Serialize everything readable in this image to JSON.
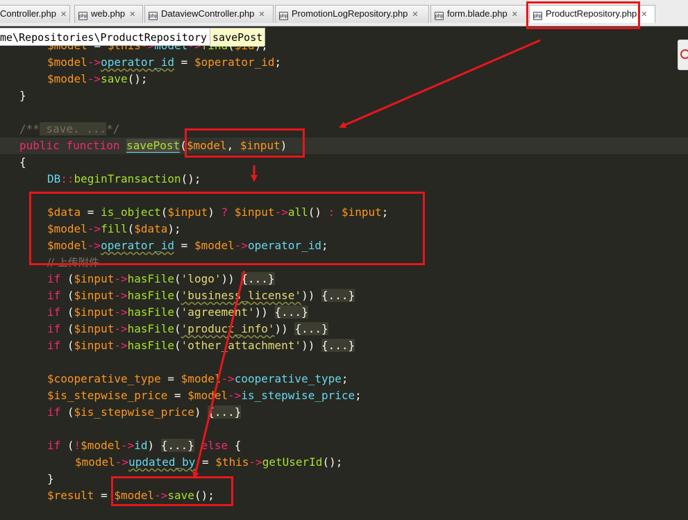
{
  "tabs": [
    {
      "label": "Controller.php",
      "close": "✕"
    },
    {
      "label": "web.php",
      "close": "✕"
    },
    {
      "label": "DataviewController.php",
      "close": "✕"
    },
    {
      "label": "PromotionLogRepository.php",
      "close": "✕"
    },
    {
      "label": "form.blade.php",
      "close": "✕"
    },
    {
      "label": "ProductRepository.php",
      "close": "✕",
      "active": true
    }
  ],
  "tab_icon_text": "php",
  "breadcrumb": {
    "path": "me\\Repositories\\ProductRepository",
    "method": "savePost"
  },
  "code": {
    "l0": [
      "$model",
      " = ",
      "$this",
      "->",
      "model",
      "->",
      "find",
      "(",
      "$id",
      ");"
    ],
    "l1": [
      "$model",
      "->",
      "operator_id",
      " = ",
      "$operator_id",
      ";"
    ],
    "l2": [
      "$model",
      "->",
      "save",
      "();"
    ],
    "l3": [
      "}"
    ],
    "l5": [
      "/**",
      " save. ...",
      "*/"
    ],
    "l6": [
      "public",
      " ",
      "function",
      " ",
      "savePost",
      "(",
      "$model",
      ", ",
      "$input",
      ")"
    ],
    "l7": [
      "{"
    ],
    "l8": [
      "DB",
      "::",
      "beginTransaction",
      "();"
    ],
    "l10": [
      "$data",
      " = ",
      "is_object",
      "(",
      "$input",
      ") ",
      "?",
      " ",
      "$input",
      "->",
      "all",
      "() ",
      ":",
      " ",
      "$input",
      ";"
    ],
    "l11": [
      "$model",
      "->",
      "fill",
      "(",
      "$data",
      ");"
    ],
    "l12": [
      "$model",
      "->",
      "operator_id",
      " = ",
      "$model",
      "->",
      "operator_id",
      ";"
    ],
    "l13": [
      "// 上传附件"
    ],
    "l14": [
      "if",
      " (",
      "$input",
      "->",
      "hasFile",
      "(",
      "'logo'",
      ")) ",
      "{...}"
    ],
    "l15": [
      "if",
      " (",
      "$input",
      "->",
      "hasFile",
      "(",
      "'business_license'",
      ")) ",
      "{...}"
    ],
    "l16": [
      "if",
      " (",
      "$input",
      "->",
      "hasFile",
      "(",
      "'agreement'",
      ")) ",
      "{...}"
    ],
    "l17": [
      "if",
      " (",
      "$input",
      "->",
      "hasFile",
      "(",
      "'product_info'",
      ")) ",
      "{...}"
    ],
    "l18": [
      "if",
      " (",
      "$input",
      "->",
      "hasFile",
      "(",
      "'other_attachment'",
      ")) ",
      "{...}"
    ],
    "l20": [
      "$cooperative_type",
      " = ",
      "$model",
      "->",
      "cooperative_type",
      ";"
    ],
    "l21": [
      "$is_stepwise_price",
      " = ",
      "$model",
      "->",
      "is_stepwise_price",
      ";"
    ],
    "l22": [
      "if",
      " (",
      "$is_stepwise_price",
      ") ",
      "{...}"
    ],
    "l24": [
      "if",
      " (",
      "!",
      "$model",
      "->",
      "id",
      ") ",
      "{...}",
      " ",
      "else",
      " {"
    ],
    "l25": [
      "$model",
      "->",
      "updated_by",
      " = ",
      "$this",
      "->",
      "getUserId",
      "();"
    ],
    "l26": [
      "}"
    ],
    "l27": [
      "$result",
      " = ",
      "$model",
      "->",
      "save",
      "();"
    ]
  },
  "colors": {
    "background": "#272822",
    "annotation": "#e8161c",
    "keyword": "#f92672",
    "variable": "#fd971f",
    "function": "#a6e22e",
    "string": "#e6db74",
    "comment": "#75715e"
  }
}
